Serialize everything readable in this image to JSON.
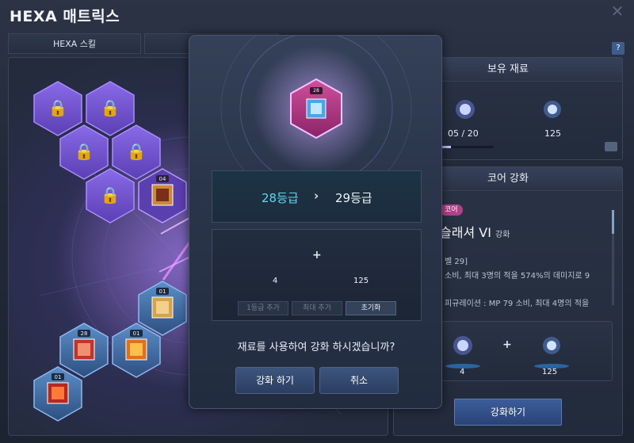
{
  "window": {
    "title": "HEXA 매트릭스"
  },
  "tabs": [
    {
      "label": "HEXA 스킬"
    },
    {
      "label": ""
    }
  ],
  "left_panel": {
    "nodes": [
      {
        "label": "04"
      },
      {
        "label": "01"
      },
      {
        "label": "28"
      },
      {
        "label": "01"
      },
      {
        "label": "01"
      }
    ]
  },
  "materials": {
    "header": "보유 재료",
    "fragment_count": "05 / 20",
    "fragment_progress": 0.25,
    "shard_count": "125"
  },
  "core_upgrade": {
    "header": "코어 강화",
    "tag": "코어",
    "skill_name": "슬래셔 VI",
    "skill_suffix": "강화",
    "line1": "벨 29]",
    "line2": "소비, 최대 3명의 적을 574%의 데미지로 9",
    "line3": "피규레이션 : MP 79 소비, 최대 4명의 적을",
    "cost_a": "4",
    "cost_b": "125",
    "button": "강화하기"
  },
  "modal": {
    "badge_label": "28",
    "grade_from": "28등급",
    "grade_arrow": "›",
    "grade_to": "29등급",
    "cost_a": "4",
    "cost_b": "125",
    "plus": "+",
    "btn_plus_one": "1등급 추가",
    "btn_max": "최대 추가",
    "btn_reset": "초기화",
    "question": "재료를 사용하여 강화 하시겠습니까?",
    "confirm": "강화 하기",
    "cancel": "취소"
  },
  "colors": {
    "accent_cyan": "#5fd8f0",
    "lock_purple": "#7c5cd6",
    "button_blue": "#3b5d9a",
    "core_tag_pink": "#b4408a"
  }
}
